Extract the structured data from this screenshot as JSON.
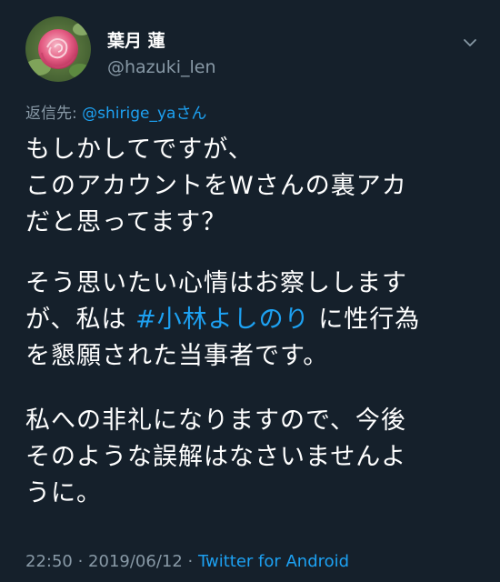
{
  "user": {
    "display_name": "葉月 蓮",
    "handle": "@hazuki_len",
    "avatar_icon": "rose-avatar-icon"
  },
  "menu_icon": "chevron-down-icon",
  "reply": {
    "prefix": "返信先: ",
    "mention": "@shirige_ya",
    "suffix": "さん"
  },
  "body": {
    "para1": [
      "もしかしてですが、",
      "このアカウントをWさんの裏アカ",
      "だと思ってます？"
    ],
    "para2": {
      "line1": "そう思いたい心情はお察しします",
      "line2_before": "が、私は",
      "hashtag": "#小林よしのり",
      "line2_after": "に性行為",
      "line3": "を懇願された当事者です。"
    },
    "para3": [
      "私への非礼になりますので、今後",
      "そのような誤解はなさいませんよ",
      "うに。"
    ]
  },
  "meta": {
    "time": "22:50",
    "sep1": " · ",
    "date": "2019/06/12",
    "sep2": " · ",
    "source": "Twitter for Android"
  },
  "colors": {
    "background": "#15202b",
    "link": "#1da1f2",
    "secondary_text": "#8899a6",
    "primary_text": "#ffffff"
  }
}
